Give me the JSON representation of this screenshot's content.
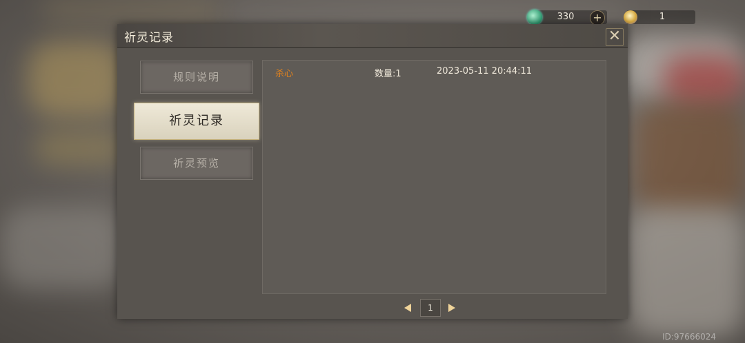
{
  "currency": {
    "jade_icon": "jade-coin-icon",
    "jade_amount": "330",
    "add_label": "+",
    "orb_icon": "spirit-orb-icon",
    "orb_amount": "1"
  },
  "dialog": {
    "title": "祈灵记录",
    "close_label": "✕"
  },
  "tabs": [
    {
      "label": "规则说明"
    },
    {
      "label": "祈灵记录"
    },
    {
      "label": "祈灵预览"
    }
  ],
  "records": [
    {
      "item": "杀心",
      "quantity": "数量:1",
      "time": "2023-05-11 20:44:11"
    }
  ],
  "pager": {
    "current_page": "1"
  },
  "watermark": "ID:97666024",
  "colors": {
    "item_highlight": "#e0821e",
    "active_tab_bg": "#efe9d8"
  }
}
